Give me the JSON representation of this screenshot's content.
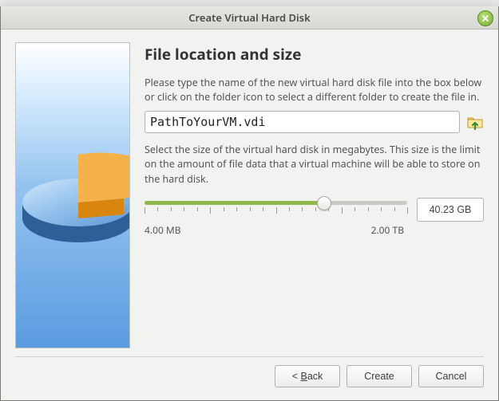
{
  "window": {
    "title": "Create Virtual Hard Disk"
  },
  "heading": "File location and size",
  "desc1": "Please type the name of the new virtual hard disk file into the box below or click on the folder icon to select a different folder to create the file in.",
  "path": {
    "value": "PathToYourVM.vdi"
  },
  "desc2": "Select the size of the virtual hard disk in megabytes. This size is the limit on the amount of file data that a virtual machine will be able to store on the hard disk.",
  "slider": {
    "min_label": "4.00 MB",
    "max_label": "2.00 TB",
    "value": "40.23 GB"
  },
  "buttons": {
    "back_pre": "< ",
    "back_u": "B",
    "back_post": "ack",
    "create": "Create",
    "cancel": "Cancel"
  }
}
